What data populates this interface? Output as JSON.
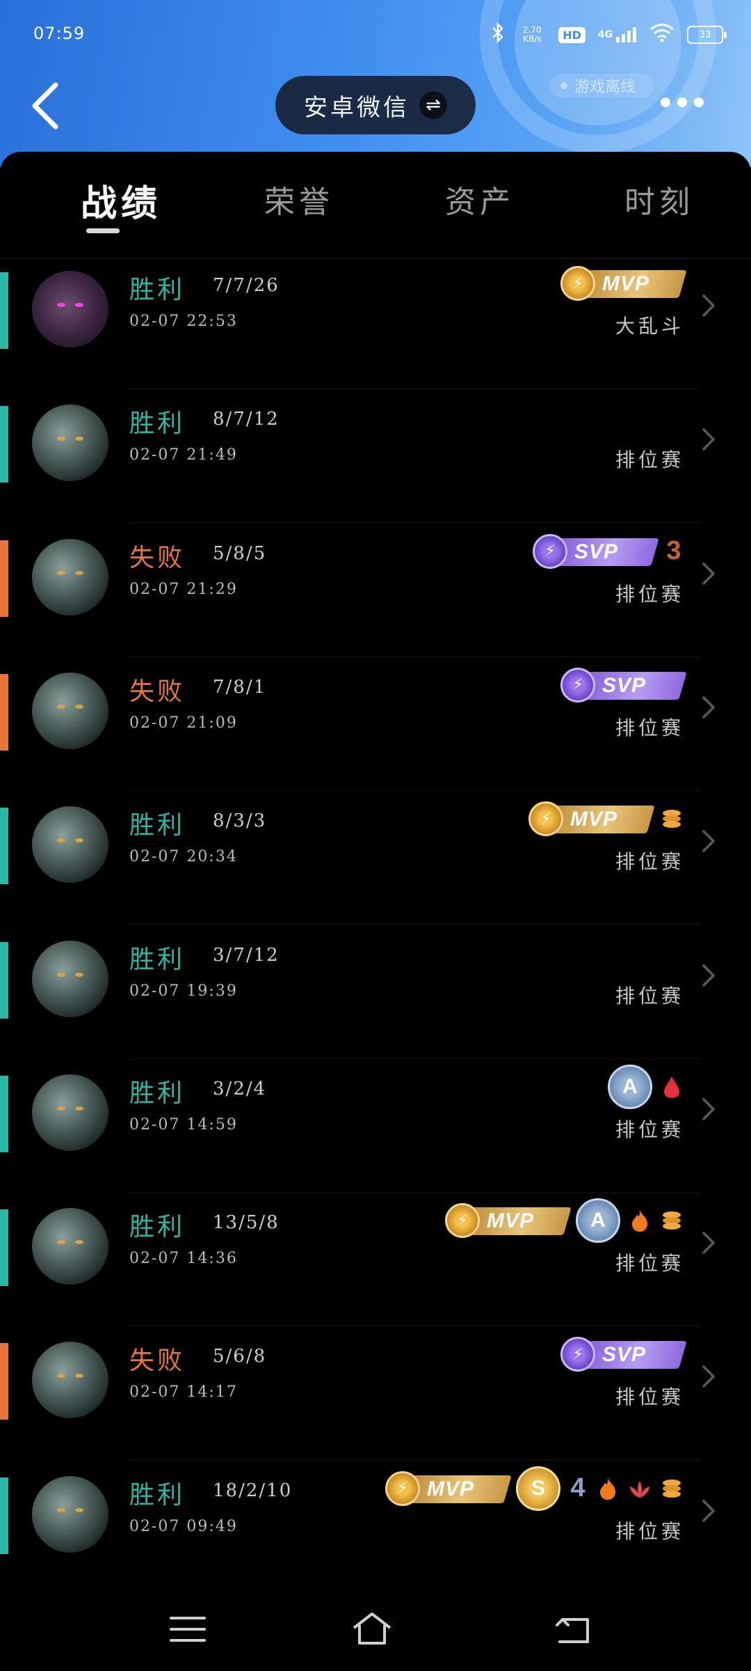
{
  "status_bar": {
    "time": "07:59",
    "net_speed": "2.70 KB/s",
    "hd": "HD",
    "network": "4G",
    "battery": "33"
  },
  "header": {
    "account_label": "安卓微信",
    "offline_tag": "游戏离线",
    "accent": "#3f8df0"
  },
  "tabs": [
    "战绩",
    "荣誉",
    "资产",
    "时刻"
  ],
  "colors": {
    "win": "#2bb7a6",
    "lose": "#e77438"
  },
  "matches": [
    {
      "result": "胜利",
      "outcome": "win",
      "kda": "7/7/26",
      "datetime": "02-07 22:53",
      "mode": "大乱斗",
      "avatar": "hero-avatar-purple-eyes",
      "badges": [
        "mvp"
      ]
    },
    {
      "result": "胜利",
      "outcome": "win",
      "kda": "8/7/12",
      "datetime": "02-07 21:49",
      "mode": "排位赛",
      "avatar": "hero-avatar-beast",
      "badges": []
    },
    {
      "result": "失败",
      "outcome": "lose",
      "kda": "5/8/5",
      "datetime": "02-07 21:29",
      "mode": "排位赛",
      "avatar": "hero-avatar-beast",
      "badges": [
        "svp",
        "rank-3"
      ]
    },
    {
      "result": "失败",
      "outcome": "lose",
      "kda": "7/8/1",
      "datetime": "02-07 21:09",
      "mode": "排位赛",
      "avatar": "hero-avatar-beast",
      "badges": [
        "svp"
      ]
    },
    {
      "result": "胜利",
      "outcome": "win",
      "kda": "8/3/3",
      "datetime": "02-07 20:34",
      "mode": "排位赛",
      "avatar": "hero-avatar-beast",
      "badges": [
        "mvp",
        "coins"
      ]
    },
    {
      "result": "胜利",
      "outcome": "win",
      "kda": "3/7/12",
      "datetime": "02-07 19:39",
      "mode": "排位赛",
      "avatar": "hero-avatar-beast",
      "badges": []
    },
    {
      "result": "胜利",
      "outcome": "win",
      "kda": "3/2/4",
      "datetime": "02-07 14:59",
      "mode": "排位赛",
      "avatar": "hero-avatar-beast",
      "badges": [
        "grade-a",
        "blood"
      ]
    },
    {
      "result": "胜利",
      "outcome": "win",
      "kda": "13/5/8",
      "datetime": "02-07 14:36",
      "mode": "排位赛",
      "avatar": "hero-avatar-beast",
      "badges": [
        "mvp",
        "grade-a",
        "fire",
        "coins"
      ]
    },
    {
      "result": "失败",
      "outcome": "lose",
      "kda": "5/6/8",
      "datetime": "02-07 14:17",
      "mode": "排位赛",
      "avatar": "hero-avatar-beast",
      "badges": [
        "svp"
      ]
    },
    {
      "result": "胜利",
      "outcome": "win",
      "kda": "18/2/10",
      "datetime": "02-07 09:49",
      "mode": "排位赛",
      "avatar": "hero-avatar-beast",
      "badges": [
        "mvp",
        "grade-s",
        "rank-4",
        "fire",
        "lotus",
        "coins"
      ]
    }
  ],
  "badge_text": {
    "mvp": "MVP",
    "svp": "SVP",
    "grade_a": "A",
    "grade_s": "S",
    "rank_3": "3",
    "rank_4": "4"
  },
  "nav": [
    "menu-icon",
    "home-icon",
    "back-icon"
  ]
}
